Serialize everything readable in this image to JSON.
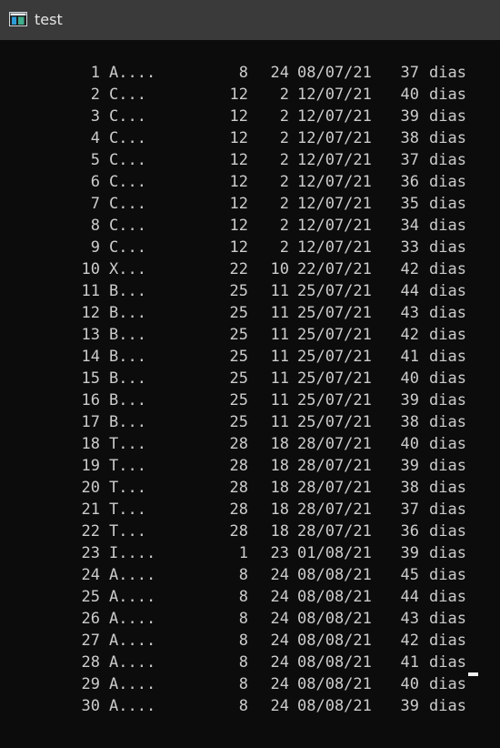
{
  "window": {
    "title": "test",
    "icon": "console-window-icon"
  },
  "console": {
    "rows": [
      {
        "n": "1",
        "name": "A....",
        "a": "8",
        "b": "24",
        "date": "08/07/21",
        "days": "37",
        "unit": "dias"
      },
      {
        "n": "2",
        "name": "C...",
        "a": "12",
        "b": "2",
        "date": "12/07/21",
        "days": "40",
        "unit": "dias"
      },
      {
        "n": "3",
        "name": "C...",
        "a": "12",
        "b": "2",
        "date": "12/07/21",
        "days": "39",
        "unit": "dias"
      },
      {
        "n": "4",
        "name": "C...",
        "a": "12",
        "b": "2",
        "date": "12/07/21",
        "days": "38",
        "unit": "dias"
      },
      {
        "n": "5",
        "name": "C...",
        "a": "12",
        "b": "2",
        "date": "12/07/21",
        "days": "37",
        "unit": "dias"
      },
      {
        "n": "6",
        "name": "C...",
        "a": "12",
        "b": "2",
        "date": "12/07/21",
        "days": "36",
        "unit": "dias"
      },
      {
        "n": "7",
        "name": "C...",
        "a": "12",
        "b": "2",
        "date": "12/07/21",
        "days": "35",
        "unit": "dias"
      },
      {
        "n": "8",
        "name": "C...",
        "a": "12",
        "b": "2",
        "date": "12/07/21",
        "days": "34",
        "unit": "dias"
      },
      {
        "n": "9",
        "name": "C...",
        "a": "12",
        "b": "2",
        "date": "12/07/21",
        "days": "33",
        "unit": "dias"
      },
      {
        "n": "10",
        "name": "X...",
        "a": "22",
        "b": "10",
        "date": "22/07/21",
        "days": "42",
        "unit": "dias"
      },
      {
        "n": "11",
        "name": "B...",
        "a": "25",
        "b": "11",
        "date": "25/07/21",
        "days": "44",
        "unit": "dias"
      },
      {
        "n": "12",
        "name": "B...",
        "a": "25",
        "b": "11",
        "date": "25/07/21",
        "days": "43",
        "unit": "dias"
      },
      {
        "n": "13",
        "name": "B...",
        "a": "25",
        "b": "11",
        "date": "25/07/21",
        "days": "42",
        "unit": "dias"
      },
      {
        "n": "14",
        "name": "B...",
        "a": "25",
        "b": "11",
        "date": "25/07/21",
        "days": "41",
        "unit": "dias"
      },
      {
        "n": "15",
        "name": "B...",
        "a": "25",
        "b": "11",
        "date": "25/07/21",
        "days": "40",
        "unit": "dias"
      },
      {
        "n": "16",
        "name": "B...",
        "a": "25",
        "b": "11",
        "date": "25/07/21",
        "days": "39",
        "unit": "dias"
      },
      {
        "n": "17",
        "name": "B...",
        "a": "25",
        "b": "11",
        "date": "25/07/21",
        "days": "38",
        "unit": "dias"
      },
      {
        "n": "18",
        "name": "T...",
        "a": "28",
        "b": "18",
        "date": "28/07/21",
        "days": "40",
        "unit": "dias"
      },
      {
        "n": "19",
        "name": "T...",
        "a": "28",
        "b": "18",
        "date": "28/07/21",
        "days": "39",
        "unit": "dias"
      },
      {
        "n": "20",
        "name": "T...",
        "a": "28",
        "b": "18",
        "date": "28/07/21",
        "days": "38",
        "unit": "dias"
      },
      {
        "n": "21",
        "name": "T...",
        "a": "28",
        "b": "18",
        "date": "28/07/21",
        "days": "37",
        "unit": "dias"
      },
      {
        "n": "22",
        "name": "T...",
        "a": "28",
        "b": "18",
        "date": "28/07/21",
        "days": "36",
        "unit": "dias"
      },
      {
        "n": "23",
        "name": "I....",
        "a": "1",
        "b": "23",
        "date": "01/08/21",
        "days": "39",
        "unit": "dias"
      },
      {
        "n": "24",
        "name": "A....",
        "a": "8",
        "b": "24",
        "date": "08/08/21",
        "days": "45",
        "unit": "dias"
      },
      {
        "n": "25",
        "name": "A....",
        "a": "8",
        "b": "24",
        "date": "08/08/21",
        "days": "44",
        "unit": "dias"
      },
      {
        "n": "26",
        "name": "A....",
        "a": "8",
        "b": "24",
        "date": "08/08/21",
        "days": "43",
        "unit": "dias"
      },
      {
        "n": "27",
        "name": "A....",
        "a": "8",
        "b": "24",
        "date": "08/08/21",
        "days": "42",
        "unit": "dias"
      },
      {
        "n": "28",
        "name": "A....",
        "a": "8",
        "b": "24",
        "date": "08/08/21",
        "days": "41",
        "unit": "dias"
      },
      {
        "n": "29",
        "name": "A....",
        "a": "8",
        "b": "24",
        "date": "08/08/21",
        "days": "40",
        "unit": "dias"
      },
      {
        "n": "30",
        "name": "A....",
        "a": "8",
        "b": "24",
        "date": "08/08/21",
        "days": "39",
        "unit": "dias"
      }
    ]
  },
  "colors": {
    "titlebar": "#3a3a3a",
    "background": "#0c0c0c",
    "text": "#cccccc",
    "cursor": "#f0f0f0"
  }
}
